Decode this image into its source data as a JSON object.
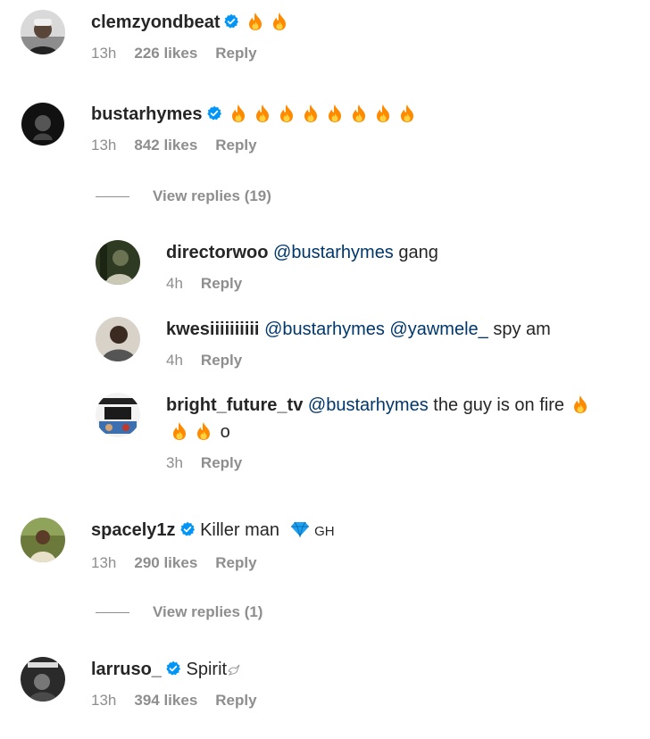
{
  "comments": [
    {
      "username": "clemzyondbeat",
      "verified": true,
      "text": "",
      "fire_count": 2,
      "time": "13h",
      "likes": "226 likes",
      "reply_label": "Reply"
    },
    {
      "username": "bustarhymes",
      "verified": true,
      "text": "",
      "fire_count": 8,
      "time": "13h",
      "likes": "842 likes",
      "reply_label": "Reply",
      "view_replies": "View replies (19)",
      "replies": [
        {
          "username": "directorwoo",
          "mention": "@bustarhymes",
          "text": " gang",
          "time": "4h",
          "reply_label": "Reply"
        },
        {
          "username": "kwesiiiiiiiiii",
          "mention": "@bustarhymes",
          "mention2": "@yawmele_",
          "text": " spy am",
          "time": "4h",
          "reply_label": "Reply"
        },
        {
          "username": "bright_future_tv",
          "mention": "@bustarhymes",
          "text": " the guy is on fire",
          "text2": "o",
          "time": "3h",
          "reply_label": "Reply"
        }
      ]
    },
    {
      "username": "spacely1z",
      "verified": true,
      "text": "Killer man",
      "suffix": "GH",
      "time": "13h",
      "likes": "290 likes",
      "reply_label": "Reply",
      "view_replies": "View replies (1)"
    },
    {
      "username": "larruso_",
      "verified": true,
      "text": "Spirit",
      "suffix_icon": "dove-icon",
      "time": "13h",
      "likes": "394 likes",
      "reply_label": "Reply"
    }
  ],
  "colors": {
    "verified": "#0095f6",
    "mention": "#00376b",
    "meta": "#8e8e8e",
    "fire": "#ff8a00"
  }
}
